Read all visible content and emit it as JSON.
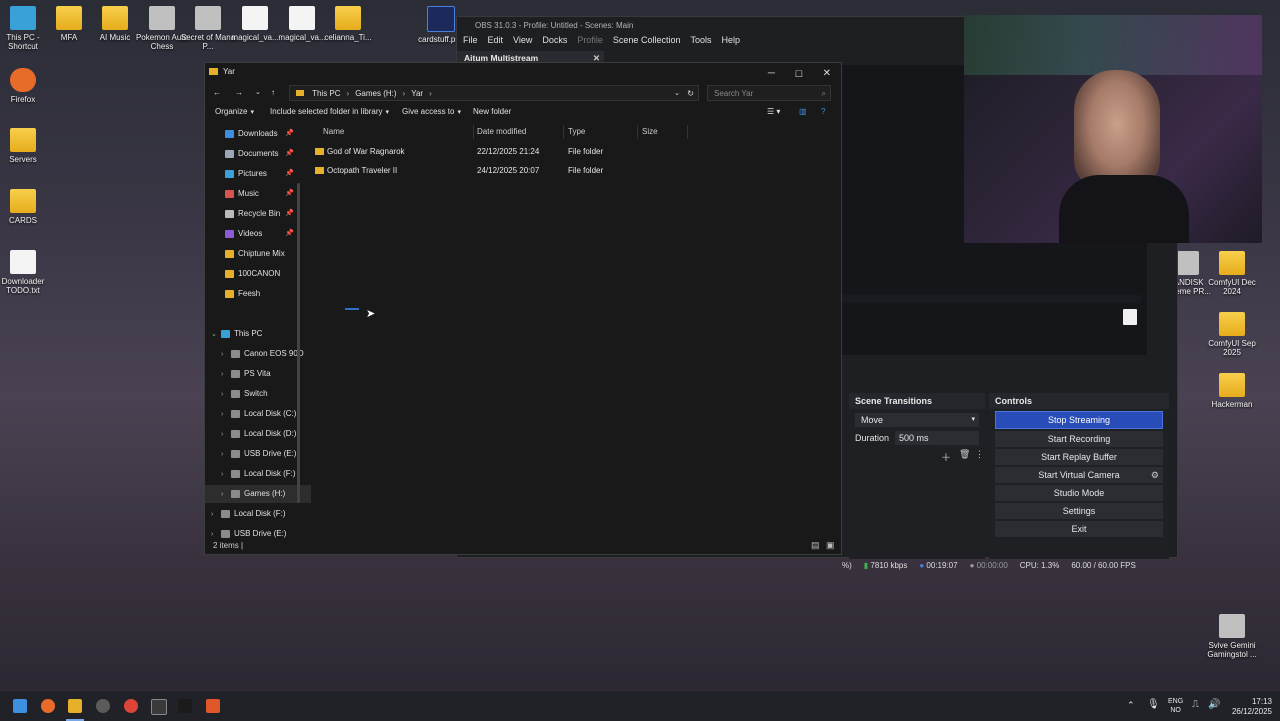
{
  "desktop": {
    "left_icons": [
      {
        "label": "This PC - Shortcut",
        "kind": "pc"
      },
      {
        "label": "MFA",
        "kind": "folder"
      },
      {
        "label": "AI Music",
        "kind": "folder"
      },
      {
        "label": "Pokemon Auto Chess",
        "kind": "app"
      },
      {
        "label": "Secret of Mana P...",
        "kind": "app"
      },
      {
        "label": "magical_va...",
        "kind": "file"
      },
      {
        "label": "magical_va...",
        "kind": "file"
      },
      {
        "label": "celianna_Ti...",
        "kind": "folder"
      },
      {
        "label": "cardstuff.psd",
        "kind": "psd"
      }
    ],
    "left_column": [
      {
        "label": "Firefox",
        "kind": "firefox"
      },
      {
        "label": "Servers",
        "kind": "folder"
      },
      {
        "label": "CARDS",
        "kind": "folder"
      },
      {
        "label": "Downloader TODO.txt",
        "kind": "file"
      }
    ],
    "right_icons": [
      {
        "label": "SANDISK Extreme PR...",
        "kind": "app"
      },
      {
        "label": "ComfyUI Dec 2024",
        "kind": "folder"
      },
      {
        "label": "ComfyUI Sep 2025",
        "kind": "folder"
      },
      {
        "label": "Hackerman",
        "kind": "folder"
      },
      {
        "label": "Svive Gemini Gamingstol ...",
        "kind": "app"
      }
    ]
  },
  "obs": {
    "title": "OBS 31.0.3 - Profile: Untitled - Scenes: Main",
    "menu": [
      "File",
      "Edit",
      "View",
      "Docks",
      "Profile",
      "Scene Collection",
      "Tools",
      "Help"
    ],
    "dock_tab": "Aitum Multistream",
    "scene_transitions": {
      "title": "Scene Transitions",
      "transition": "Move",
      "duration_label": "Duration",
      "duration_value": "500 ms"
    },
    "controls": {
      "title": "Controls",
      "buttons": [
        "Stop Streaming",
        "Start Recording",
        "Start Replay Buffer",
        "Start Virtual Camera",
        "Studio Mode",
        "Settings",
        "Exit"
      ]
    },
    "status": {
      "percent": "%)",
      "bitrate": "7810 kbps",
      "stream_time": "00:19:07",
      "rec_time": "00:00:00",
      "cpu": "CPU: 1.3%",
      "fps": "60.00 / 60.00 FPS"
    }
  },
  "explorer": {
    "title": "Yar",
    "breadcrumb": [
      "This PC",
      "Games (H:)",
      "Yar"
    ],
    "search_placeholder": "Search Yar",
    "commands": [
      "Organize",
      "Include selected folder in library",
      "Give access to",
      "New folder"
    ],
    "nav": [
      {
        "label": "Downloads",
        "color": "#3d8fe0",
        "pin": true
      },
      {
        "label": "Documents",
        "color": "#9aa7b8",
        "pin": true
      },
      {
        "label": "Pictures",
        "color": "#3aa0d8",
        "pin": true
      },
      {
        "label": "Music",
        "color": "#d9534f",
        "pin": true
      },
      {
        "label": "Recycle Bin",
        "color": "#bbbbbb",
        "pin": true
      },
      {
        "label": "Videos",
        "color": "#8a5cd6",
        "pin": true
      },
      {
        "label": "Chiptune Mix",
        "color": "#e6b02a",
        "pin": false
      },
      {
        "label": "100CANON",
        "color": "#e6b02a",
        "pin": false
      },
      {
        "label": "Feesh",
        "color": "#e6b02a",
        "pin": false
      }
    ],
    "tree": [
      {
        "label": "This PC",
        "expanded": true,
        "indent": 0
      },
      {
        "label": "Canon EOS 90D",
        "indent": 1
      },
      {
        "label": "PS Vita",
        "indent": 1
      },
      {
        "label": "Switch",
        "indent": 1
      },
      {
        "label": "Local Disk (C:)",
        "indent": 1
      },
      {
        "label": "Local Disk (D:)",
        "indent": 1
      },
      {
        "label": "USB Drive (E:)",
        "indent": 1
      },
      {
        "label": "Local Disk (F:)",
        "indent": 1
      },
      {
        "label": "Games (H:)",
        "indent": 1,
        "selected": true
      },
      {
        "label": "Local Disk (F:)",
        "indent": 0
      },
      {
        "label": "USB Drive (E:)",
        "indent": 0
      }
    ],
    "columns": [
      "Name",
      "Date modified",
      "Type",
      "Size"
    ],
    "rows": [
      {
        "name": "God of War Ragnarok",
        "date": "22/12/2025 21:24",
        "type": "File folder",
        "size": ""
      },
      {
        "name": "Octopath Traveler II",
        "date": "24/12/2025 20:07",
        "type": "File folder",
        "size": ""
      }
    ],
    "status": "2 items"
  },
  "taskbar": {
    "lang_top": "ENG",
    "lang_bottom": "NO",
    "time": "17:13",
    "date": "26/12/2025"
  }
}
